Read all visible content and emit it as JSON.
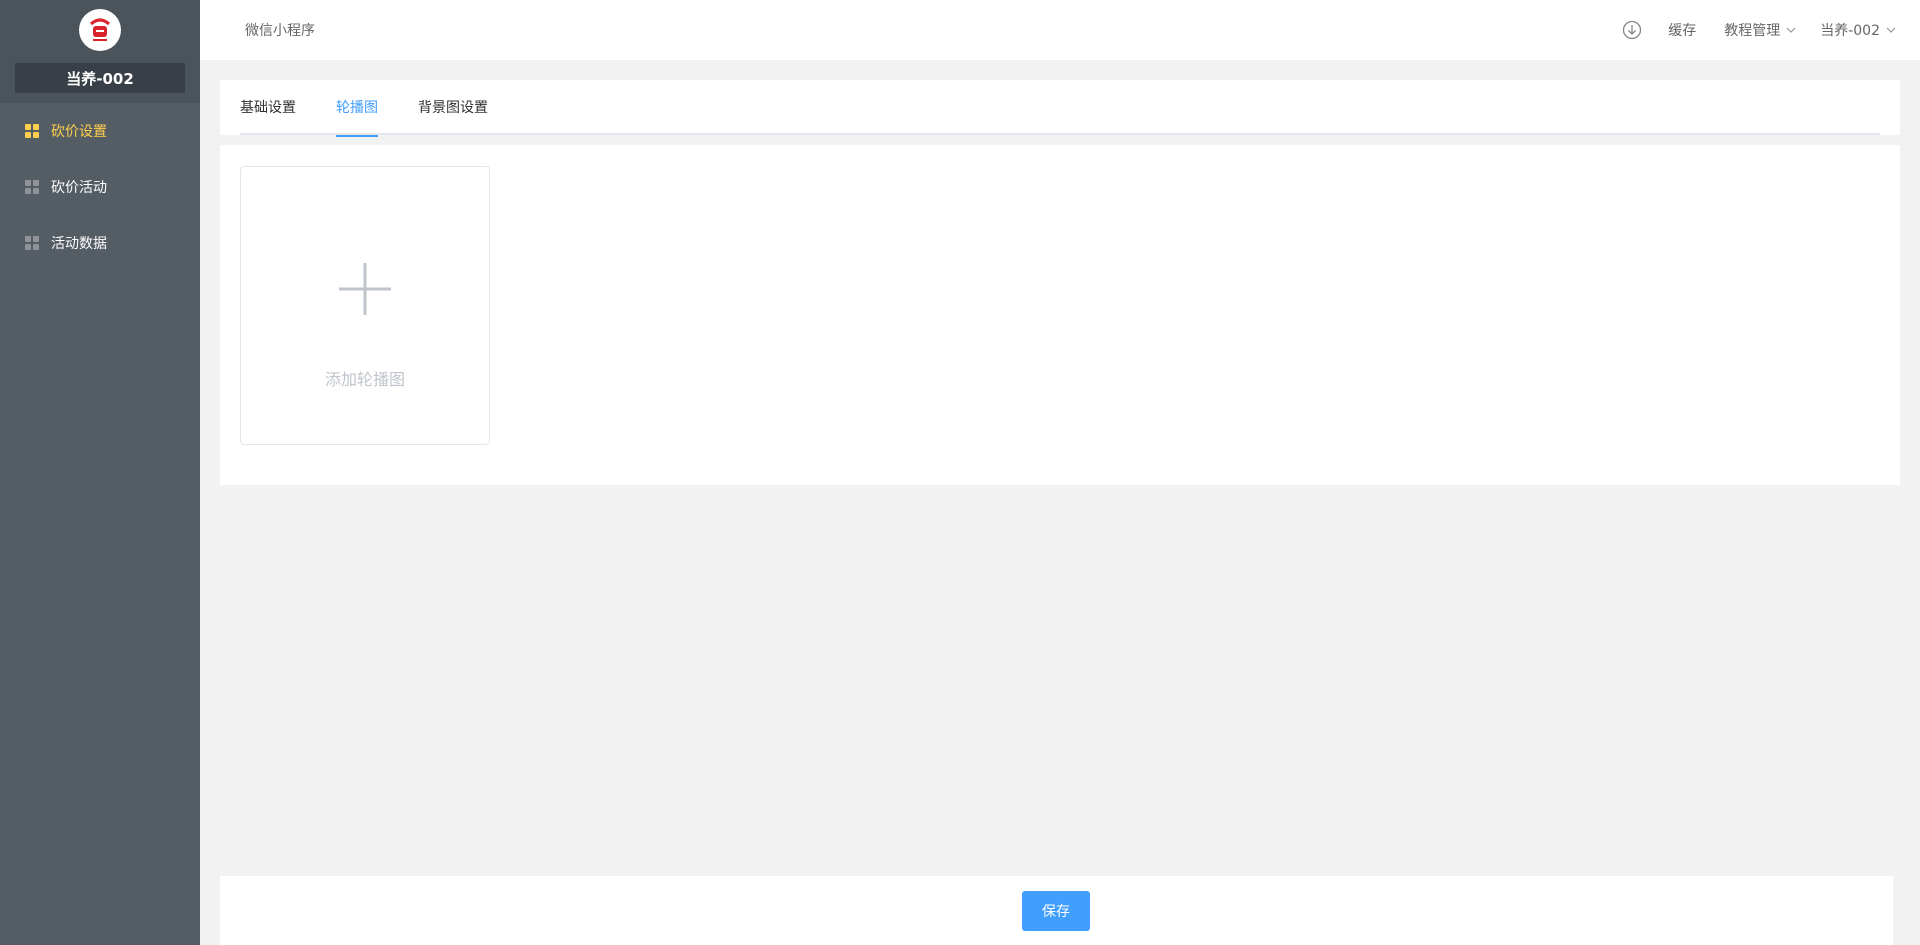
{
  "sidebar": {
    "store_name": "当养-002",
    "items": [
      {
        "label": "砍价设置",
        "active": true
      },
      {
        "label": "砍价活动",
        "active": false
      },
      {
        "label": "活动数据",
        "active": false
      }
    ]
  },
  "header": {
    "breadcrumb": "微信小程序",
    "cache_label": "缓存",
    "tutorial_label": "教程管理",
    "user_label": "当养-002"
  },
  "tabs": [
    {
      "label": "基础设置",
      "active": false
    },
    {
      "label": "轮播图",
      "active": true
    },
    {
      "label": "背景图设置",
      "active": false
    }
  ],
  "upload": {
    "label": "添加轮播图"
  },
  "footer": {
    "save_label": "保存"
  },
  "colors": {
    "sidebar_bg": "#545c64",
    "active_menu": "#ffd04b",
    "accent": "#409eff",
    "logo_red": "#d9242b"
  },
  "icons": {
    "logo": "brand-logo",
    "menu": "grid-icon",
    "download": "download-icon",
    "chevron": "chevron-down-icon",
    "plus": "plus-icon"
  }
}
